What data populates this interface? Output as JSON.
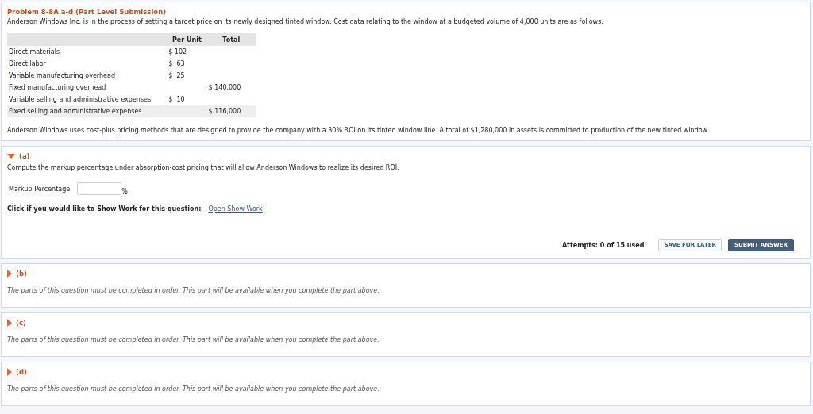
{
  "problem": {
    "title": "Problem 8-8A a-d (Part Level Submission)",
    "intro": "Anderson Windows Inc. is in the process of setting a target price on its newly designed tinted window. Cost data relating to the window at a budgeted volume of 4,000 units are as follows.",
    "table": {
      "columns": [
        "",
        "Per Unit",
        "Total"
      ],
      "rows": [
        {
          "label": "Direct materials",
          "per_unit": "$ 102",
          "total": "",
          "shaded": false
        },
        {
          "label": "Direct labor",
          "per_unit": "$  63",
          "total": "",
          "shaded": false
        },
        {
          "label": "Variable manufacturing overhead",
          "per_unit": "$  25",
          "total": "",
          "shaded": false
        },
        {
          "label": "Fixed manufacturing overhead",
          "per_unit": "",
          "total": "$ 140,000",
          "shaded": false
        },
        {
          "label": "Variable selling and administrative expenses",
          "per_unit": "$  10",
          "total": "",
          "shaded": false
        },
        {
          "label": "Fixed selling and administrative expenses",
          "per_unit": "",
          "total": "$ 116,000",
          "shaded": true
        }
      ]
    },
    "note": "Anderson Windows uses cost-plus pricing methods that are designed to provide the company with a 30% ROI on its tinted window line. A total of $1,280,000 in assets is committed to production of the new tinted window."
  },
  "parts": [
    {
      "label": "(a)",
      "expanded": true,
      "question": "Compute the markup percentage under absorption-cost pricing that will allow Anderson Windows to realize its desired ROI.",
      "field_label": "Markup Percentage",
      "unit": "%",
      "show_work_prompt": "Click if you would like to Show Work for this question:",
      "show_work_link": "Open Show Work",
      "attempts": "Attempts: 0 of 15 used",
      "buttons": [
        "SAVE FOR LATER",
        "SUBMIT ANSWER"
      ]
    },
    {
      "label": "(b)",
      "expanded": false,
      "message": "The parts of this question must be completed in order. This part will be available when you complete the part above."
    },
    {
      "label": "(c)",
      "expanded": false,
      "message": "The parts of this question must be completed in order. This part will be available when you complete the part above."
    },
    {
      "label": "(d)",
      "expanded": false,
      "message": "The parts of this question must be completed in order. This part will be available when you complete the part above."
    }
  ]
}
